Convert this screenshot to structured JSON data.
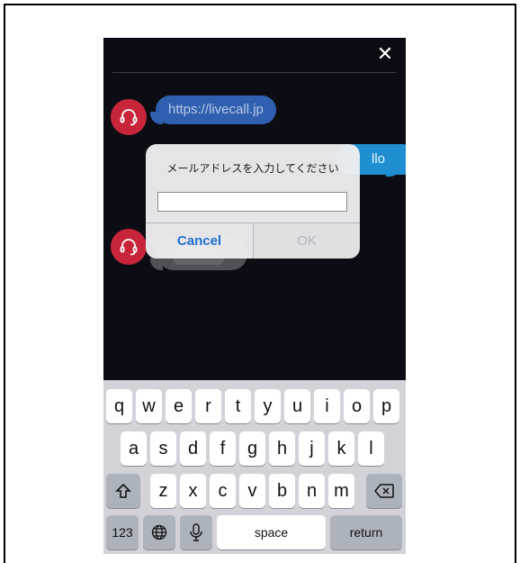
{
  "chat": {
    "agent_link": "https://livecall.jp",
    "user_message_partial": "llo"
  },
  "dialog": {
    "title": "メールアドレスを入力してください",
    "input_value": "",
    "cancel_label": "Cancel",
    "ok_label": "OK"
  },
  "icons": {
    "close": "close-icon",
    "agent": "headset-icon",
    "shift": "shift-icon",
    "backspace": "backspace-icon",
    "globe": "globe-icon",
    "mic": "microphone-icon"
  },
  "keyboard": {
    "row1": [
      "q",
      "w",
      "e",
      "r",
      "t",
      "y",
      "u",
      "i",
      "o",
      "p"
    ],
    "row2": [
      "a",
      "s",
      "d",
      "f",
      "g",
      "h",
      "j",
      "k",
      "l"
    ],
    "row3": [
      "z",
      "x",
      "c",
      "v",
      "b",
      "n",
      "m"
    ],
    "numbers_label": "123",
    "space_label": "space",
    "return_label": "return"
  },
  "colors": {
    "background": "#0c0d14",
    "agent_avatar": "#c8253a",
    "agent_bubble": "#2f5fae",
    "user_bubble": "#1f8fd1",
    "cancel_text": "#1f6fd1"
  }
}
